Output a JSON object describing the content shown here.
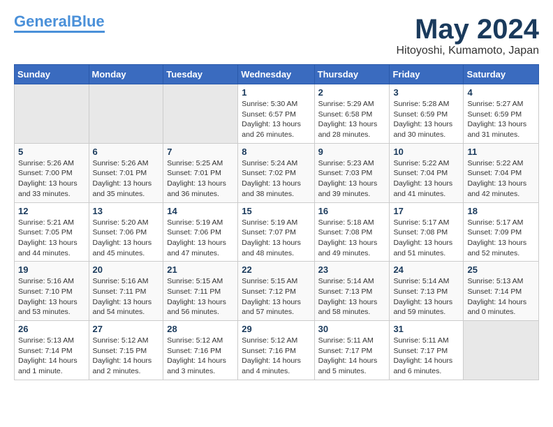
{
  "logo": {
    "text1": "General",
    "text2": "Blue"
  },
  "title": "May 2024",
  "location": "Hitoyoshi, Kumamoto, Japan",
  "days_of_week": [
    "Sunday",
    "Monday",
    "Tuesday",
    "Wednesday",
    "Thursday",
    "Friday",
    "Saturday"
  ],
  "weeks": [
    [
      {
        "day": "",
        "info": ""
      },
      {
        "day": "",
        "info": ""
      },
      {
        "day": "",
        "info": ""
      },
      {
        "day": "1",
        "info": "Sunrise: 5:30 AM\nSunset: 6:57 PM\nDaylight: 13 hours\nand 26 minutes."
      },
      {
        "day": "2",
        "info": "Sunrise: 5:29 AM\nSunset: 6:58 PM\nDaylight: 13 hours\nand 28 minutes."
      },
      {
        "day": "3",
        "info": "Sunrise: 5:28 AM\nSunset: 6:59 PM\nDaylight: 13 hours\nand 30 minutes."
      },
      {
        "day": "4",
        "info": "Sunrise: 5:27 AM\nSunset: 6:59 PM\nDaylight: 13 hours\nand 31 minutes."
      }
    ],
    [
      {
        "day": "5",
        "info": "Sunrise: 5:26 AM\nSunset: 7:00 PM\nDaylight: 13 hours\nand 33 minutes."
      },
      {
        "day": "6",
        "info": "Sunrise: 5:26 AM\nSunset: 7:01 PM\nDaylight: 13 hours\nand 35 minutes."
      },
      {
        "day": "7",
        "info": "Sunrise: 5:25 AM\nSunset: 7:01 PM\nDaylight: 13 hours\nand 36 minutes."
      },
      {
        "day": "8",
        "info": "Sunrise: 5:24 AM\nSunset: 7:02 PM\nDaylight: 13 hours\nand 38 minutes."
      },
      {
        "day": "9",
        "info": "Sunrise: 5:23 AM\nSunset: 7:03 PM\nDaylight: 13 hours\nand 39 minutes."
      },
      {
        "day": "10",
        "info": "Sunrise: 5:22 AM\nSunset: 7:04 PM\nDaylight: 13 hours\nand 41 minutes."
      },
      {
        "day": "11",
        "info": "Sunrise: 5:22 AM\nSunset: 7:04 PM\nDaylight: 13 hours\nand 42 minutes."
      }
    ],
    [
      {
        "day": "12",
        "info": "Sunrise: 5:21 AM\nSunset: 7:05 PM\nDaylight: 13 hours\nand 44 minutes."
      },
      {
        "day": "13",
        "info": "Sunrise: 5:20 AM\nSunset: 7:06 PM\nDaylight: 13 hours\nand 45 minutes."
      },
      {
        "day": "14",
        "info": "Sunrise: 5:19 AM\nSunset: 7:06 PM\nDaylight: 13 hours\nand 47 minutes."
      },
      {
        "day": "15",
        "info": "Sunrise: 5:19 AM\nSunset: 7:07 PM\nDaylight: 13 hours\nand 48 minutes."
      },
      {
        "day": "16",
        "info": "Sunrise: 5:18 AM\nSunset: 7:08 PM\nDaylight: 13 hours\nand 49 minutes."
      },
      {
        "day": "17",
        "info": "Sunrise: 5:17 AM\nSunset: 7:08 PM\nDaylight: 13 hours\nand 51 minutes."
      },
      {
        "day": "18",
        "info": "Sunrise: 5:17 AM\nSunset: 7:09 PM\nDaylight: 13 hours\nand 52 minutes."
      }
    ],
    [
      {
        "day": "19",
        "info": "Sunrise: 5:16 AM\nSunset: 7:10 PM\nDaylight: 13 hours\nand 53 minutes."
      },
      {
        "day": "20",
        "info": "Sunrise: 5:16 AM\nSunset: 7:11 PM\nDaylight: 13 hours\nand 54 minutes."
      },
      {
        "day": "21",
        "info": "Sunrise: 5:15 AM\nSunset: 7:11 PM\nDaylight: 13 hours\nand 56 minutes."
      },
      {
        "day": "22",
        "info": "Sunrise: 5:15 AM\nSunset: 7:12 PM\nDaylight: 13 hours\nand 57 minutes."
      },
      {
        "day": "23",
        "info": "Sunrise: 5:14 AM\nSunset: 7:13 PM\nDaylight: 13 hours\nand 58 minutes."
      },
      {
        "day": "24",
        "info": "Sunrise: 5:14 AM\nSunset: 7:13 PM\nDaylight: 13 hours\nand 59 minutes."
      },
      {
        "day": "25",
        "info": "Sunrise: 5:13 AM\nSunset: 7:14 PM\nDaylight: 14 hours\nand 0 minutes."
      }
    ],
    [
      {
        "day": "26",
        "info": "Sunrise: 5:13 AM\nSunset: 7:14 PM\nDaylight: 14 hours\nand 1 minute."
      },
      {
        "day": "27",
        "info": "Sunrise: 5:12 AM\nSunset: 7:15 PM\nDaylight: 14 hours\nand 2 minutes."
      },
      {
        "day": "28",
        "info": "Sunrise: 5:12 AM\nSunset: 7:16 PM\nDaylight: 14 hours\nand 3 minutes."
      },
      {
        "day": "29",
        "info": "Sunrise: 5:12 AM\nSunset: 7:16 PM\nDaylight: 14 hours\nand 4 minutes."
      },
      {
        "day": "30",
        "info": "Sunrise: 5:11 AM\nSunset: 7:17 PM\nDaylight: 14 hours\nand 5 minutes."
      },
      {
        "day": "31",
        "info": "Sunrise: 5:11 AM\nSunset: 7:17 PM\nDaylight: 14 hours\nand 6 minutes."
      },
      {
        "day": "",
        "info": ""
      }
    ]
  ]
}
